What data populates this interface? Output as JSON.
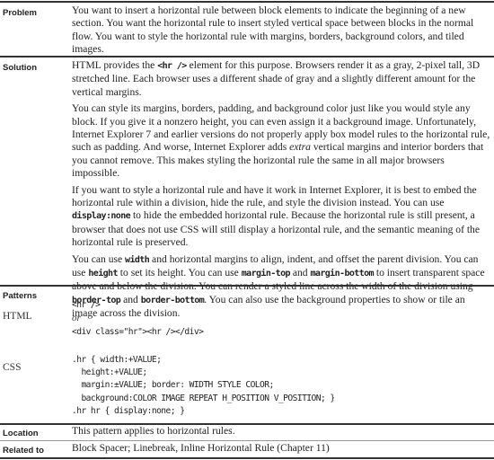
{
  "problem": {
    "label": "Problem",
    "paragraphs": [
      [
        {
          "t": "You want to insert a horizontal rule between block elements to indicate the beginning of a new section. You want the horizontal rule to insert styled vertical space between blocks in the normal flow. You want to style the horizontal rule with margins, borders, background colors, and tiled images."
        }
      ]
    ]
  },
  "solution": {
    "label": "Solution",
    "paragraphs": [
      [
        {
          "t": "HTML provides the "
        },
        {
          "t": "<hr />",
          "code": true
        },
        {
          "t": " element for this purpose. Browsers render it as a gray, 2-pixel tall, 3D stretched line. Each browser uses a different shade of gray and a slightly different amount for the vertical margins."
        }
      ],
      [
        {
          "t": "You can style its margins, borders, padding, and background color just like you would style any block. If you give it a nonzero height, you can even assign it a background image. Unfortunately, Internet Explorer 7 and earlier versions do not properly apply box model rules to the horizontal rule, such as padding. And worse, Internet Explorer adds "
        },
        {
          "t": "extra",
          "em": true
        },
        {
          "t": " vertical margins and interior borders that you cannot remove. This makes styling the horizontal rule the same in all major browsers impossible."
        }
      ],
      [
        {
          "t": "If you want to style a horizontal rule and have it work in Internet Explorer, it is best to embed the horizontal rule within a division, hide the rule, and style the division instead. You can use "
        },
        {
          "t": "display:none",
          "code": true
        },
        {
          "t": " to hide the embedded horizontal rule. Because the horizontal rule is still present, a browser that does not use CSS will still display a horizontal rule, and the semantic meaning of the horizontal rule is preserved."
        }
      ],
      [
        {
          "t": "You can use "
        },
        {
          "t": "width",
          "code": true
        },
        {
          "t": " and horizontal margins to align, indent, and offset the parent division. You can use "
        },
        {
          "t": "height",
          "code": true
        },
        {
          "t": " to set its height. You can use "
        },
        {
          "t": "margin-top",
          "code": true
        },
        {
          "t": " and "
        },
        {
          "t": "margin-bottom",
          "code": true
        },
        {
          "t": " to insert transparent space above and below the division. You can render a styled line across the width of the division using "
        },
        {
          "t": "border-top",
          "code": true
        },
        {
          "t": " and "
        },
        {
          "t": "border-bottom",
          "code": true
        },
        {
          "t": ". You can also use the background properties to show or tile an image across the division."
        }
      ]
    ]
  },
  "patterns": {
    "label": "Patterns",
    "html_label": "HTML",
    "html_code_1": "<hr />",
    "or": "or",
    "html_code_2": "<div class=\"hr\"><hr /></div>",
    "css_label": "CSS",
    "css_code": ".hr { width:+VALUE;\n  height:+VALUE;\n  margin:±VALUE; border: WIDTH STYLE COLOR;\n  background:COLOR IMAGE REPEAT H_POSITION V_POSITION; }\n.hr hr { display:none; }"
  },
  "location": {
    "label": "Location",
    "text": "This pattern applies to horizontal rules."
  },
  "related": {
    "label": "Related to",
    "text": "Block Spacer; Linebreak, Inline Horizontal Rule (Chapter 11)"
  }
}
